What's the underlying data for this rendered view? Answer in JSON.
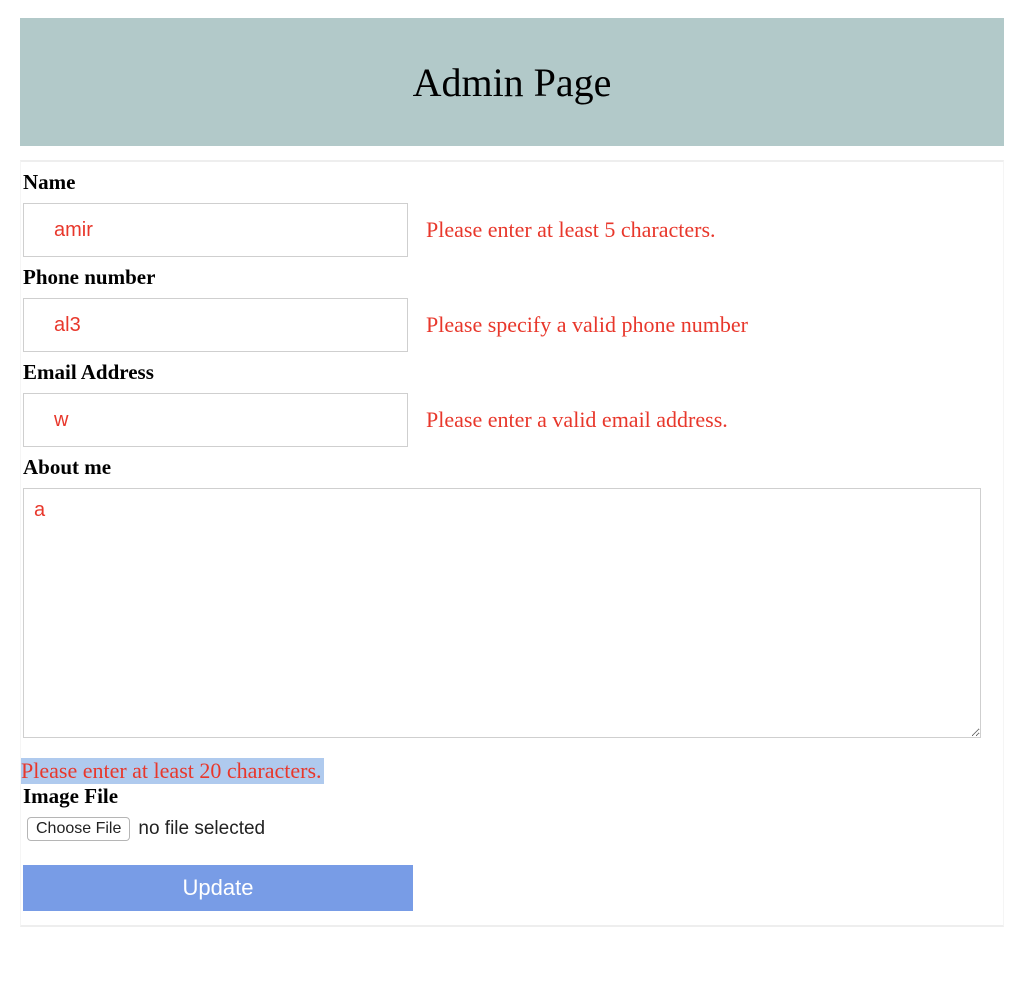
{
  "header": {
    "title": "Admin Page"
  },
  "form": {
    "name": {
      "label": "Name",
      "value": "amir",
      "error": "Please enter at least 5 characters."
    },
    "phone": {
      "label": "Phone number",
      "value": "al3",
      "error": "Please specify a valid phone number"
    },
    "email": {
      "label": "Email Address",
      "value": "w",
      "error": "Please enter a valid email address."
    },
    "about": {
      "label": "About me",
      "value": "a",
      "error": "Please enter at least 20 characters."
    },
    "image": {
      "label": "Image File",
      "choose_label": "Choose File",
      "status": "no file selected"
    },
    "submit_label": "Update"
  }
}
